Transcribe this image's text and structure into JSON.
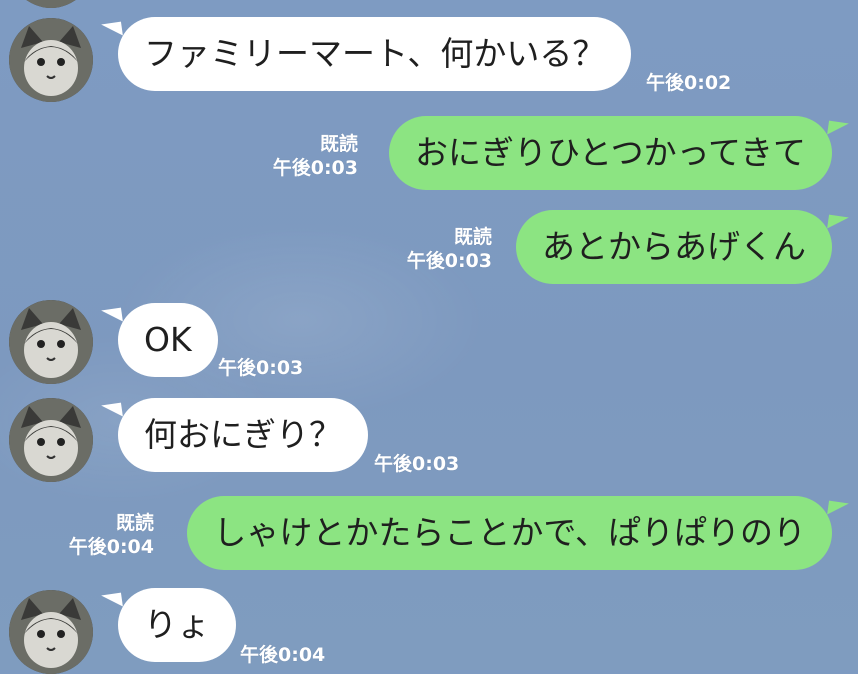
{
  "messages": [
    {
      "side": "in",
      "text": "ファミリーマート、何かいる？",
      "time": "午後0:02"
    },
    {
      "side": "out",
      "text": "おにぎりひとつかってきて",
      "time": "午後0:03",
      "read": "既読"
    },
    {
      "side": "out",
      "text": "あとからあげくん",
      "time": "午後0:03",
      "read": "既読"
    },
    {
      "side": "in",
      "text": "OK",
      "time": "午後0:03"
    },
    {
      "side": "in",
      "text": "何おにぎり？",
      "time": "午後0:03"
    },
    {
      "side": "out",
      "text": "しゃけとかたらことかで、ぱりぱりのり",
      "time": "午後0:04",
      "read": "既読"
    },
    {
      "side": "in",
      "text": "りょ",
      "time": "午後0:04"
    }
  ],
  "icons": {
    "avatar": "cat-avatar-icon"
  },
  "colors": {
    "background": "#7f9bc0",
    "incoming": "#ffffff",
    "outgoing": "#8ce482",
    "meta": "#ffffff"
  }
}
